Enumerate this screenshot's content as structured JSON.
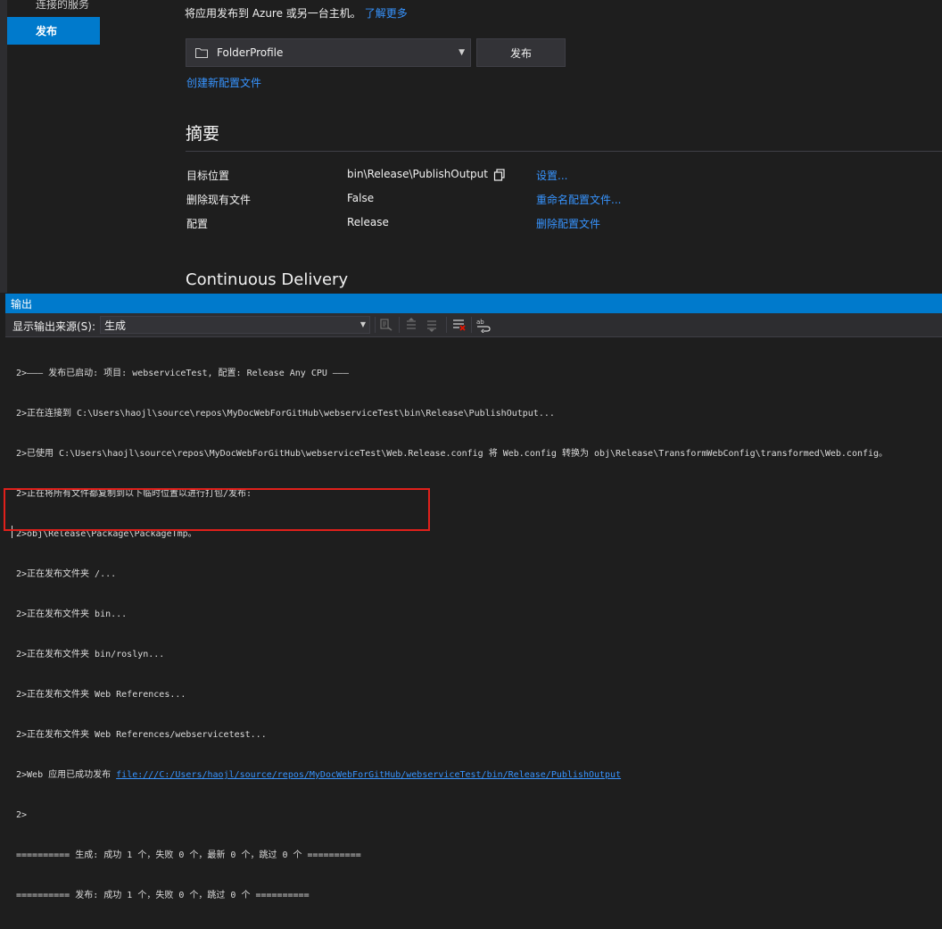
{
  "sidebar": {
    "prev_item_label": "连接的服务",
    "active_item_label": "发布"
  },
  "publish": {
    "intro_text": "将应用发布到 Azure 或另一台主机。",
    "learn_more_label": "了解更多",
    "profile_value": "FolderProfile",
    "publish_button_label": "发布",
    "create_profile_link": "创建新配置文件"
  },
  "summary": {
    "title": "摘要",
    "rows": [
      {
        "label": "目标位置",
        "value": "bin\\Release\\PublishOutput",
        "action": "设置..."
      },
      {
        "label": "删除现有文件",
        "value": "False",
        "action": "重命名配置文件..."
      },
      {
        "label": "配置",
        "value": "Release",
        "action": "删除配置文件"
      }
    ]
  },
  "continuous_delivery": {
    "title": "Continuous Delivery"
  },
  "output": {
    "title": "输出",
    "source_label": "显示输出来源(S):",
    "source_value": "生成",
    "lines": [
      "2>——— 发布已启动: 项目: webserviceTest, 配置: Release Any CPU ———",
      "2>正在连接到 C:\\Users\\haojl\\source\\repos\\MyDocWebForGitHub\\webserviceTest\\bin\\Release\\PublishOutput...",
      "2>已使用 C:\\Users\\haojl\\source\\repos\\MyDocWebForGitHub\\webserviceTest\\Web.Release.config 将 Web.config 转换为 obj\\Release\\TransformWebConfig\\transformed\\Web.config。",
      "2>正在将所有文件都复制到以下临时位置以进行打包/发布:",
      "2>obj\\Release\\Package\\PackageTmp。",
      "2>正在发布文件夹 /...",
      "2>正在发布文件夹 bin...",
      "2>正在发布文件夹 bin/roslyn...",
      "2>正在发布文件夹 Web References...",
      "2>正在发布文件夹 Web References/webservicetest...",
      "2>Web 应用已成功发布 ",
      "2>",
      "========== 生成: 成功 1 个，失败 0 个，最新 0 个，跳过 0 个 ==========",
      "========== 发布: 成功 1 个，失败 0 个，跳过 0 个 =========="
    ],
    "publish_link": "file:///C:/Users/haojl/source/repos/MyDocWebForGitHub/webserviceTest/bin/Release/PublishOutput"
  }
}
